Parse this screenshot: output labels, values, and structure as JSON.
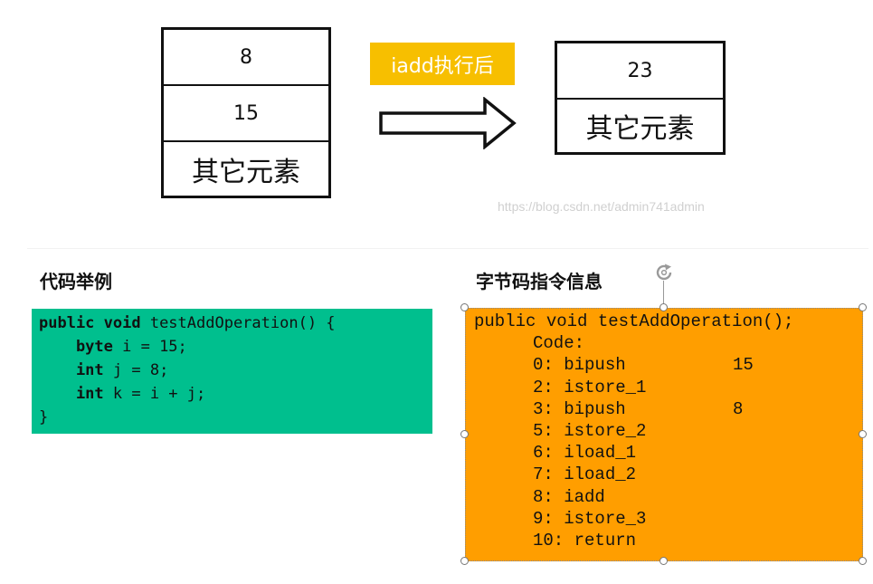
{
  "stack_before": {
    "cells": [
      "8",
      "15",
      "其它元素"
    ]
  },
  "operation_label": "iadd执行后",
  "stack_after": {
    "cells": [
      "23",
      "其它元素"
    ]
  },
  "watermark": "https://blog.csdn.net/admin741admin",
  "code_section": {
    "title": "代码举例",
    "lines": [
      {
        "kw": "public void",
        "rest": " testAddOperation() {"
      },
      {
        "kw": "    byte",
        "rest": " i = 15;"
      },
      {
        "kw": "    int",
        "rest": " j = 8;"
      },
      {
        "kw": "    int",
        "rest": " k = i + j;"
      },
      {
        "kw": "",
        "rest": "}"
      }
    ]
  },
  "bytecode_section": {
    "title": "字节码指令信息",
    "header": "public void testAddOperation();",
    "code_label": "Code:",
    "instructions": [
      {
        "text": "0: bipush",
        "operand": "15"
      },
      {
        "text": "2: istore_1",
        "operand": ""
      },
      {
        "text": "3: bipush",
        "operand": "8"
      },
      {
        "text": "5: istore_2",
        "operand": ""
      },
      {
        "text": "6: iload_1",
        "operand": ""
      },
      {
        "text": "7: iload_2",
        "operand": ""
      },
      {
        "text": "8: iadd",
        "operand": ""
      },
      {
        "text": "9: istore_3",
        "operand": ""
      },
      {
        "text": "10: return",
        "operand": ""
      }
    ]
  },
  "colors": {
    "code_bg": "#00bf8e",
    "bytecode_bg": "#ff9e00",
    "label_bg": "#f7bf00"
  }
}
